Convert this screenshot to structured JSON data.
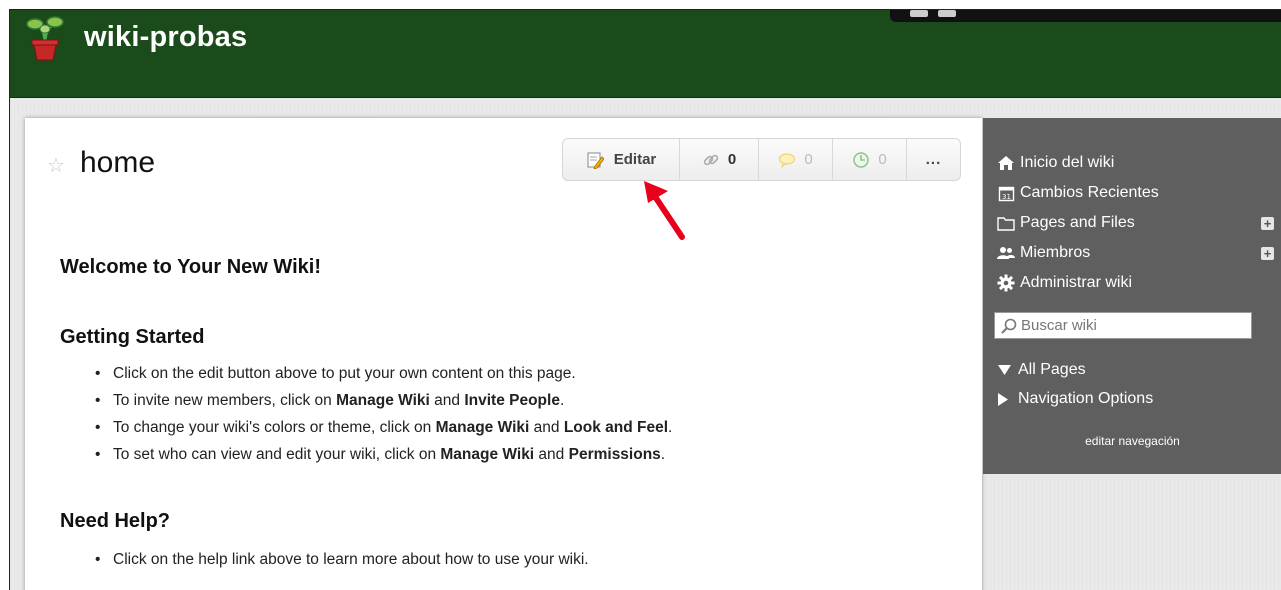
{
  "header": {
    "site_title": "wiki-probas"
  },
  "page": {
    "title": "home",
    "toolbar": {
      "edit_label": "Editar",
      "links_count": "0",
      "comments_count": "0",
      "history_count": "0",
      "more_label": "..."
    }
  },
  "content": {
    "welcome": "Welcome to Your New Wiki!",
    "getting_started": {
      "heading": "Getting Started",
      "items": [
        {
          "pre": "Click on the edit button above to put your own content on this page."
        },
        {
          "pre": "To invite new members, click on ",
          "b1": "Manage Wiki",
          "mid": " and ",
          "b2": "Invite People",
          "post": "."
        },
        {
          "pre": "To change your wiki's colors or theme, click on ",
          "b1": "Manage Wiki",
          "mid": " and ",
          "b2": "Look and Feel",
          "post": "."
        },
        {
          "pre": "To set who can view and edit your wiki, click on ",
          "b1": "Manage Wiki",
          "mid": " and ",
          "b2": "Permissions",
          "post": "."
        }
      ]
    },
    "need_help": {
      "heading": "Need Help?",
      "items": [
        {
          "pre": "Click on the help link above to learn more about how to use your wiki."
        }
      ]
    }
  },
  "sidebar": {
    "nav": [
      {
        "label": "Inicio del wiki",
        "icon": "home-icon"
      },
      {
        "label": "Cambios Recientes",
        "icon": "calendar-icon"
      },
      {
        "label": "Pages and Files",
        "icon": "folder-icon"
      },
      {
        "label": "Miembros",
        "icon": "members-icon"
      },
      {
        "label": "Administrar wiki",
        "icon": "gear-icon"
      }
    ],
    "search_placeholder": "Buscar wiki",
    "tree": [
      {
        "label": "All Pages",
        "state": "expanded"
      },
      {
        "label": "Navigation Options",
        "state": "collapsed"
      }
    ],
    "edit_navigation": "editar navegación"
  },
  "colors": {
    "header": "#1b4b1b",
    "sidebar": "#5f5f5f",
    "annotation_arrow": "#e8001c"
  }
}
